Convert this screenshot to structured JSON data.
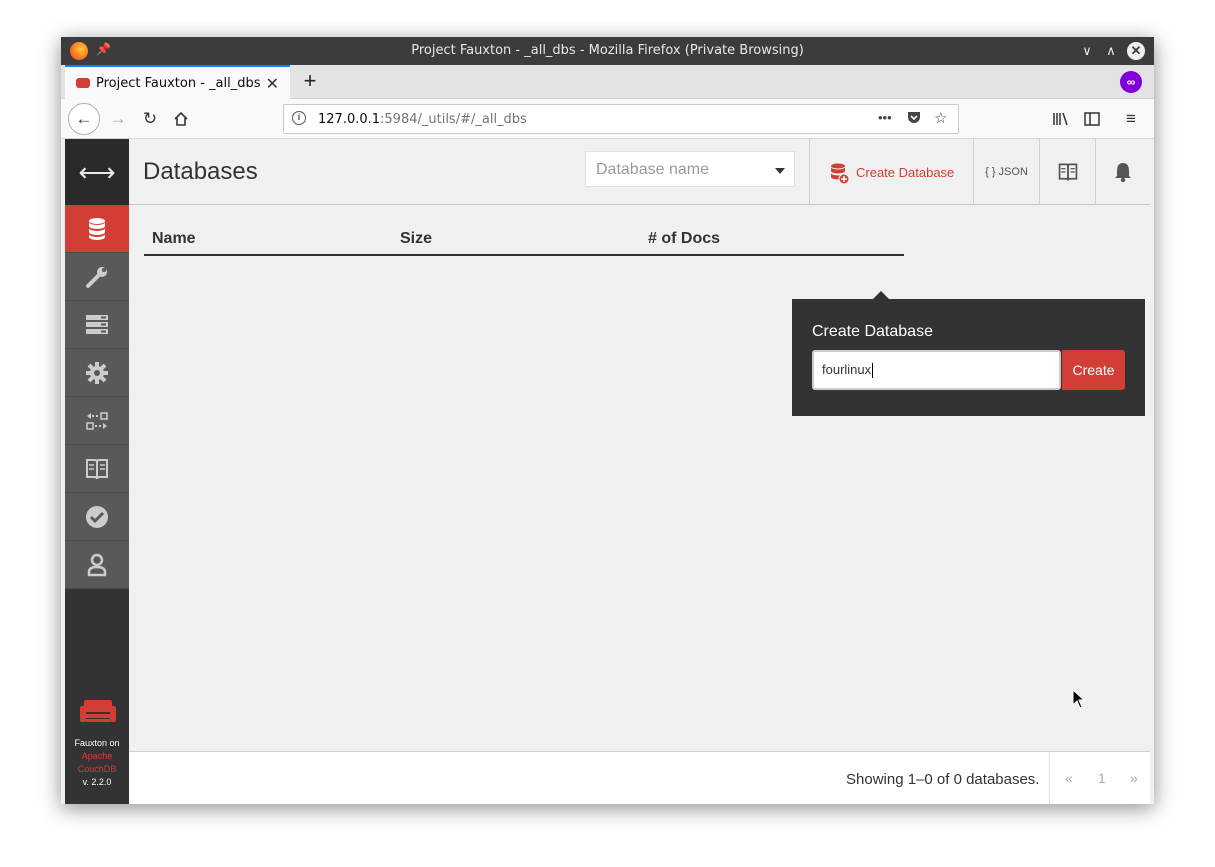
{
  "window": {
    "title": "Project Fauxton - _all_dbs - Mozilla Firefox (Private Browsing)"
  },
  "tabs": [
    {
      "title": "Project Fauxton - _all_dbs",
      "close": "✕"
    }
  ],
  "new_tab": "+",
  "nav": {
    "url_host": "127.0.0.1",
    "url_rest": ":5984/_utils/#/_all_dbs",
    "page_actions": "•••"
  },
  "app": {
    "page_title": "Databases",
    "search": {
      "placeholder": "Database name"
    },
    "header_buttons": {
      "create_database": "Create Database",
      "json": "{ } JSON"
    },
    "table": {
      "columns": [
        "Name",
        "Size",
        "# of Docs"
      ]
    },
    "footer": {
      "count_text": "Showing 1–0 of 0 databases.",
      "pager": {
        "prev": "«",
        "page": "1",
        "next": "»"
      }
    },
    "popover": {
      "title": "Create Database",
      "input_value": "fourlinux",
      "button": "Create"
    },
    "sidebar": {
      "items": [
        {
          "name": "databases",
          "icon": "database-icon",
          "active": true
        },
        {
          "name": "setup",
          "icon": "wrench-icon"
        },
        {
          "name": "active-tasks",
          "icon": "server-icon"
        },
        {
          "name": "config",
          "icon": "gear-icon"
        },
        {
          "name": "replication",
          "icon": "replication-icon"
        },
        {
          "name": "docs",
          "icon": "book-icon"
        },
        {
          "name": "verify",
          "icon": "check-icon"
        },
        {
          "name": "user",
          "icon": "user-icon"
        }
      ],
      "brand": {
        "line1": "Fauxton on",
        "line2": "Apache",
        "line3": "CouchDB",
        "version": "v. 2.2.0"
      }
    }
  },
  "colors": {
    "brand_red": "#d23d36",
    "sidebar_bg": "#333333",
    "sidebar_item": "#595959"
  }
}
